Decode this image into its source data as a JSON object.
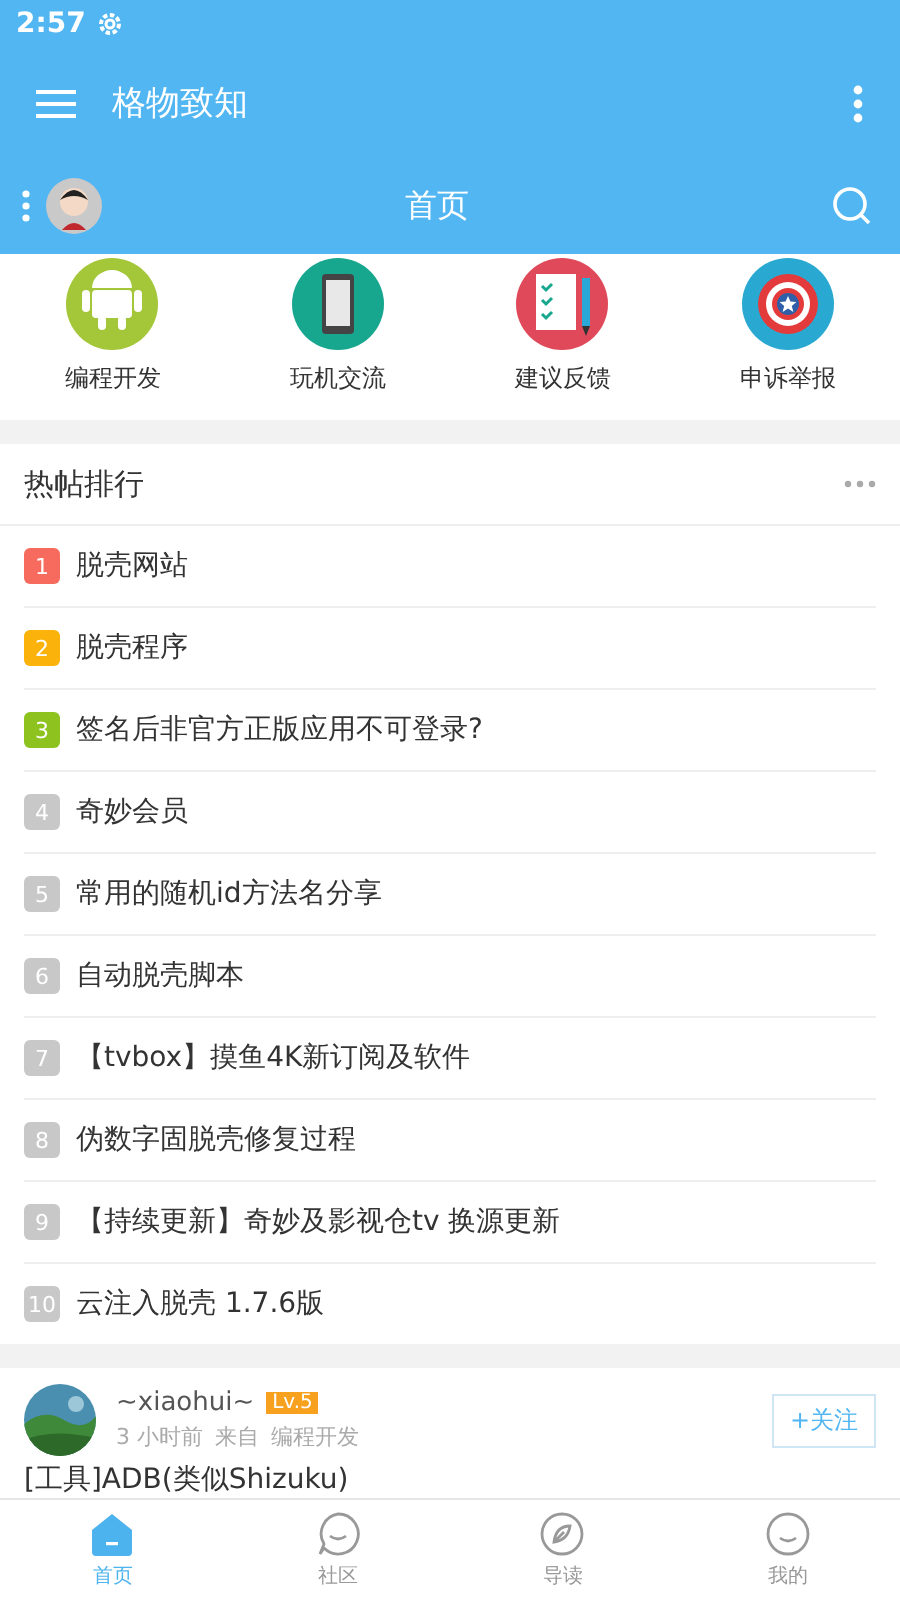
{
  "status_bar": {
    "time": "2:57"
  },
  "app_bar": {
    "title": "格物致知"
  },
  "page_header": {
    "title": "首页"
  },
  "categories": [
    {
      "label": "编程开发",
      "kind": "android"
    },
    {
      "label": "玩机交流",
      "kind": "phone"
    },
    {
      "label": "建议反馈",
      "kind": "checklist"
    },
    {
      "label": "申诉举报",
      "kind": "shield"
    }
  ],
  "hot_posts": {
    "title": "热帖排行",
    "items": [
      {
        "rank": "1",
        "title": "脱壳网站",
        "color": "#f76b5e"
      },
      {
        "rank": "2",
        "title": "脱壳程序",
        "color": "#fbb30b"
      },
      {
        "rank": "3",
        "title": "签名后非官方正版应用不可登录?",
        "color": "#8dc21f"
      },
      {
        "rank": "4",
        "title": "奇妙会员",
        "color": "#c8c8c8"
      },
      {
        "rank": "5",
        "title": "常用的随机id方法名分享",
        "color": "#c8c8c8"
      },
      {
        "rank": "6",
        "title": "自动脱壳脚本",
        "color": "#c8c8c8"
      },
      {
        "rank": "7",
        "title": "【tvbox】摸鱼4K新订阅及软件",
        "color": "#c8c8c8"
      },
      {
        "rank": "8",
        "title": "伪数字固脱壳修复过程",
        "color": "#c8c8c8"
      },
      {
        "rank": "9",
        "title": "【持续更新】奇妙及影视仓tv 换源更新",
        "color": "#c8c8c8"
      },
      {
        "rank": "10",
        "title": "云注入脱壳 1.7.6版",
        "color": "#c8c8c8"
      }
    ]
  },
  "post": {
    "author": "~xiaohui~",
    "level": "Lv.5",
    "time": "3 小时前",
    "source_prefix": "来自",
    "source": "编程开发",
    "follow": "+关注",
    "title": "[工具]ADB(类似Shizuku)"
  },
  "bottom_nav": [
    {
      "label": "首页",
      "kind": "home",
      "selected": true
    },
    {
      "label": "社区",
      "kind": "chat",
      "selected": false
    },
    {
      "label": "导读",
      "kind": "compass",
      "selected": false
    },
    {
      "label": "我的",
      "kind": "face",
      "selected": false
    }
  ]
}
